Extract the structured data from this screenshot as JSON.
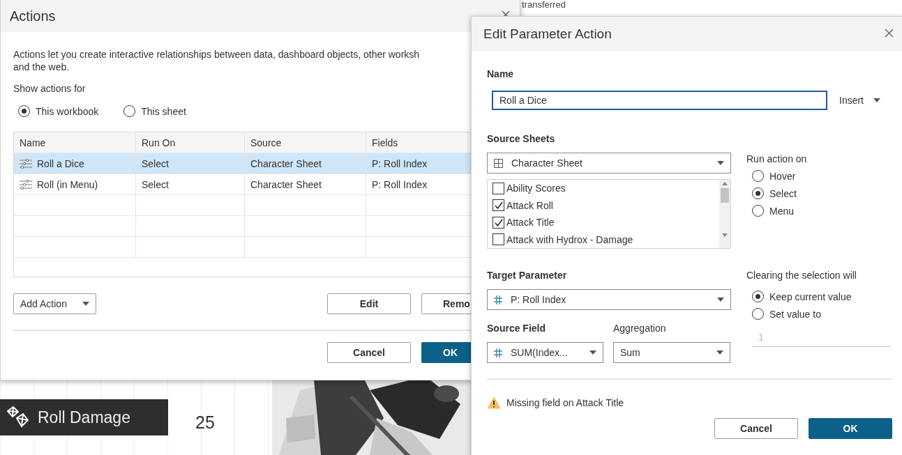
{
  "background": {
    "caption": "transferred",
    "banner": {
      "label": "Roll Damage"
    },
    "value": "25"
  },
  "actions_dialog": {
    "title": "Actions",
    "description_lines": [
      "Actions let you create interactive relationships between data, dashboard objects, other worksh",
      "and the web."
    ],
    "show_actions_for": {
      "label": "Show actions for",
      "options": [
        {
          "label": "This workbook",
          "selected": true
        },
        {
          "label": "This sheet",
          "selected": false
        }
      ]
    },
    "table": {
      "columns": [
        "Name",
        "Run On",
        "Source",
        "Fields"
      ],
      "rows": [
        {
          "cells": [
            "Roll a Dice",
            "Select",
            "Character Sheet",
            "P: Roll Index"
          ],
          "selected": true
        },
        {
          "cells": [
            "Roll (in Menu)",
            "Select",
            "Character Sheet",
            "P: Roll Index"
          ],
          "selected": false
        }
      ]
    },
    "add_action": "Add Action",
    "buttons": [
      "Edit",
      "Remo"
    ],
    "footer_buttons": [
      {
        "label": "Cancel",
        "kind": "secondary"
      },
      {
        "label": "OK",
        "kind": "primary"
      }
    ]
  },
  "edit_dialog": {
    "title": "Edit Parameter Action",
    "name_label": "Name",
    "name_value": "Roll a Dice",
    "insert": "Insert",
    "source_sheets": {
      "label": "Source Sheets",
      "dropdown": "Character Sheet",
      "sheets": [
        {
          "label": "Ability Scores",
          "checked": false
        },
        {
          "label": "Attack Roll",
          "checked": true
        },
        {
          "label": "Attack Title",
          "checked": true
        },
        {
          "label": "Attack with Hydrox - Damage",
          "checked": false
        }
      ]
    },
    "run_action_on": {
      "label": "Run action on",
      "options": [
        {
          "label": "Hover",
          "selected": false
        },
        {
          "label": "Select",
          "selected": true
        },
        {
          "label": "Menu",
          "selected": false
        }
      ]
    },
    "target_parameter": {
      "label": "Target Parameter",
      "value": "P: Roll Index"
    },
    "source_field": {
      "label": "Source Field",
      "value": "SUM(Index..."
    },
    "aggregation": {
      "label": "Aggregation",
      "value": "Sum"
    },
    "clearing": {
      "label": "Clearing the selection will",
      "options": [
        {
          "label": "Keep current value",
          "selected": true
        },
        {
          "label": "Set value to",
          "selected": false
        }
      ],
      "value_placeholder": "1"
    },
    "warning": "Missing field on Attack Title",
    "buttons": [
      {
        "label": "Cancel",
        "kind": "secondary"
      },
      {
        "label": "OK",
        "kind": "primary"
      }
    ]
  }
}
